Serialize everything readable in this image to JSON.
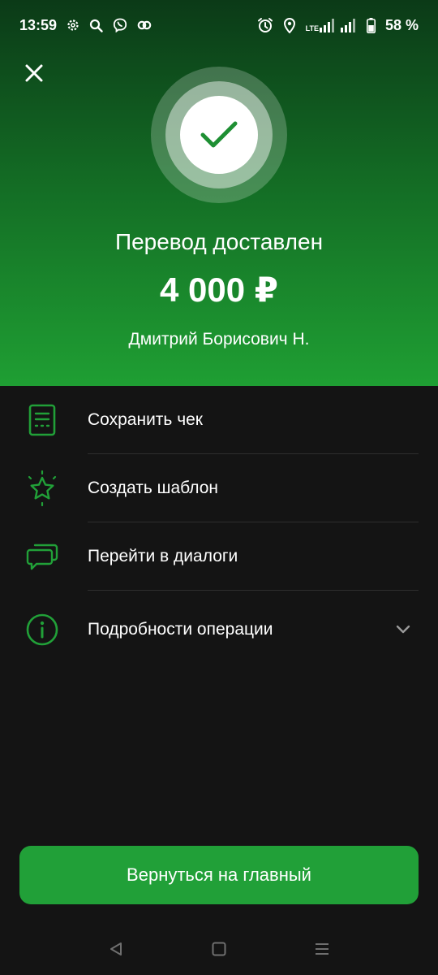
{
  "status_bar": {
    "time": "13:59",
    "battery": "58 %",
    "network": "LTE",
    "icons_left": [
      "settings-icon",
      "search-icon",
      "viber-icon",
      "link-icon"
    ],
    "icons_right": [
      "alarm-icon",
      "location-icon",
      "signal-icon",
      "battery-icon"
    ]
  },
  "result": {
    "title": "Перевод доставлен",
    "amount": "4 000 ₽",
    "recipient": "Дмитрий Борисович Н."
  },
  "menu": {
    "items": [
      {
        "label": "Сохранить чек",
        "icon": "receipt-icon"
      },
      {
        "label": "Создать шаблон",
        "icon": "star-icon"
      },
      {
        "label": "Перейти в диалоги",
        "icon": "chat-icon"
      },
      {
        "label": "Подробности операции",
        "icon": "info-icon"
      }
    ]
  },
  "primary_button": {
    "label": "Вернуться на главный"
  },
  "colors": {
    "accent": "#21a038",
    "background": "#141414",
    "divider": "#2e2e2e"
  }
}
